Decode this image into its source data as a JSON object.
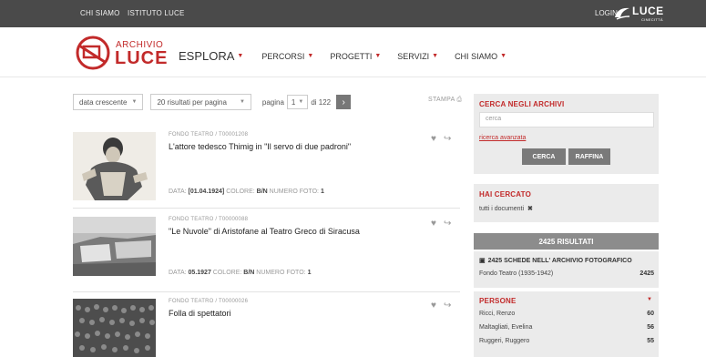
{
  "topbar": {
    "links": [
      "CHI SIAMO",
      "ISTITUTO LUCE"
    ],
    "login": "LOGIN",
    "brand": "LUCE",
    "brand_sub": "CINECITTÀ"
  },
  "logo": {
    "line1": "ARCHIVIO",
    "line2": "LUCE"
  },
  "nav": [
    {
      "label": "ESPLORA"
    },
    {
      "label": "PERCORSI"
    },
    {
      "label": "PROGETTI"
    },
    {
      "label": "SERVIZI"
    },
    {
      "label": "CHI SIAMO"
    }
  ],
  "controls": {
    "sort": "data crescente",
    "per_page": "20 risultati per pagina",
    "page_label": "pagina",
    "page_value": "1",
    "of_label": "di 122",
    "next_icon": "chevron-right-icon",
    "print": "STAMPA"
  },
  "records": [
    {
      "fondo": "FONDO TEATRO / T00001208",
      "title": "L'attore tedesco Thimig in \"Il servo di due padroni\"",
      "data_label": "DATA:",
      "data_value": "[01.04.1924]",
      "colore_label": "COLORE:",
      "colore_value": "B/N",
      "foto_label": "NUMERO FOTO:",
      "foto_value": "1"
    },
    {
      "fondo": "FONDO TEATRO / T00000088",
      "title": "\"Le Nuvole\" di Aristofane al Teatro Greco di Siracusa",
      "data_label": "DATA:",
      "data_value": "05.1927",
      "colore_label": "COLORE:",
      "colore_value": "B/N",
      "foto_label": "NUMERO FOTO:",
      "foto_value": "1"
    },
    {
      "fondo": "FONDO TEATRO / T00000026",
      "title": "Folla di spettatori",
      "data_label": "",
      "data_value": "",
      "colore_label": "",
      "colore_value": "",
      "foto_label": "",
      "foto_value": ""
    }
  ],
  "sidebar": {
    "search_title": "CERCA NEGLI ARCHIVI",
    "search_placeholder": "cerca",
    "advanced_link": "ricerca avanzata",
    "btn_search": "CERCA",
    "btn_refine": "RAFFINA",
    "searched_title": "HAI CERCATO",
    "searched_value": "tutti i documenti",
    "results_bar": "2425 RISULTATI",
    "archive_title": "2425 SCHEDE NELL' ARCHIVIO FOTOGRAFICO",
    "archive_row": {
      "label": "Fondo Teatro (1935-1942)",
      "count": "2425"
    },
    "persone_title": "PERSONE",
    "persone": [
      {
        "label": "Ricci, Renzo",
        "count": "60"
      },
      {
        "label": "Maltagliati, Evelina",
        "count": "56"
      },
      {
        "label": "Ruggeri, Ruggero",
        "count": "55"
      }
    ]
  },
  "colors": {
    "accent": "#c22a2a",
    "topbar": "#4a4a4a",
    "sidebar": "#ebebeb"
  }
}
